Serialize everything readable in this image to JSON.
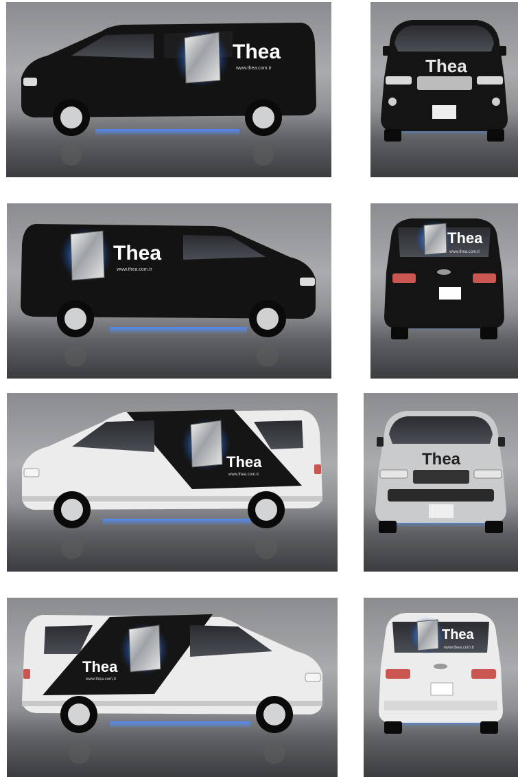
{
  "brand": {
    "logo_text": "Thea",
    "website": "www.thea.com.tr"
  },
  "vans": [
    {
      "view": "side-left",
      "body_color": "black"
    },
    {
      "view": "front",
      "body_color": "black"
    },
    {
      "view": "side-right",
      "body_color": "black"
    },
    {
      "view": "rear",
      "body_color": "black"
    },
    {
      "view": "side-left",
      "body_color": "white-black"
    },
    {
      "view": "front",
      "body_color": "silver"
    },
    {
      "view": "side-right",
      "body_color": "white-black"
    },
    {
      "view": "rear",
      "body_color": "white"
    }
  ],
  "colors": {
    "accent_blue": "#2f6fd8",
    "body_black": "#141414",
    "body_white": "#eeeeee",
    "body_silver": "#c9cbcd"
  }
}
